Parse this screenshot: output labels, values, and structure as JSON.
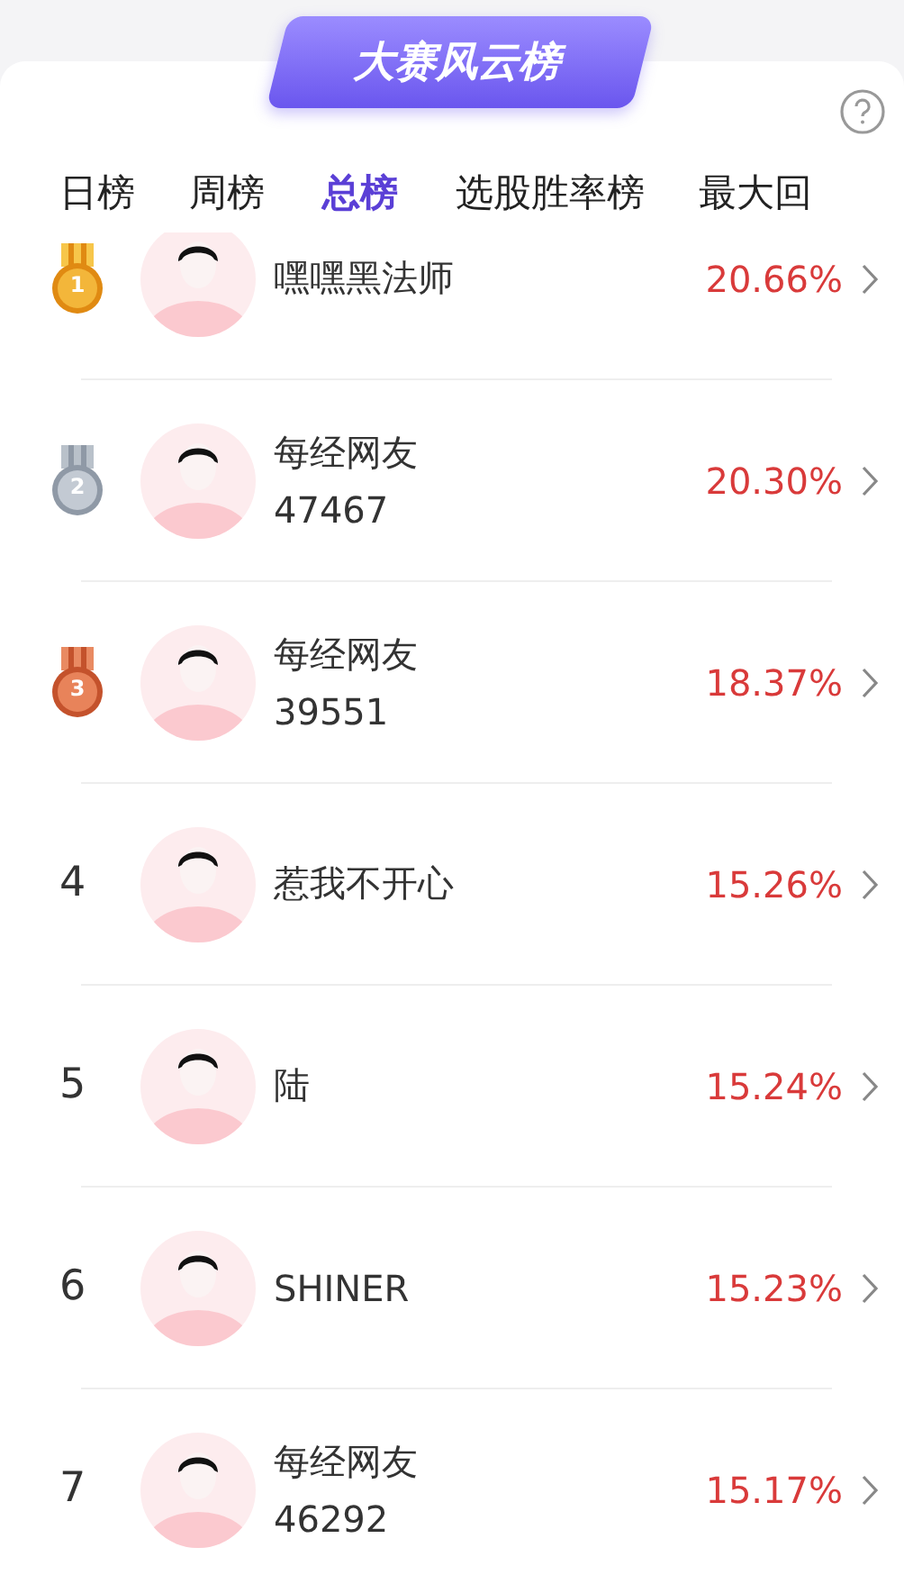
{
  "banner": {
    "title": "大赛风云榜"
  },
  "tabs": [
    {
      "label": "日榜",
      "selected": false
    },
    {
      "label": "周榜",
      "selected": false
    },
    {
      "label": "总榜",
      "selected": true
    },
    {
      "label": "选股胜率榜",
      "selected": false
    },
    {
      "label": "最大回",
      "selected": false
    }
  ],
  "rows": [
    {
      "rank": "1",
      "kind": "gold",
      "name": "嘿嘿黑法师",
      "return": "20.66%"
    },
    {
      "rank": "2",
      "kind": "silver",
      "name": "每经网友",
      "name_2": "47467",
      "return": "20.30%"
    },
    {
      "rank": "3",
      "kind": "bronze",
      "name": "每经网友",
      "name_2": "39551",
      "return": "18.37%"
    },
    {
      "rank": "4",
      "kind": "plain",
      "name": "惹我不开心",
      "return": "15.26%"
    },
    {
      "rank": "5",
      "kind": "plain",
      "name": "陆",
      "return": "15.24%"
    },
    {
      "rank": "6",
      "kind": "plain",
      "name": "SHINER",
      "return": "15.23%"
    },
    {
      "rank": "7",
      "kind": "plain",
      "name": "每经网友",
      "name_2": "46292",
      "return": "15.17%"
    }
  ]
}
